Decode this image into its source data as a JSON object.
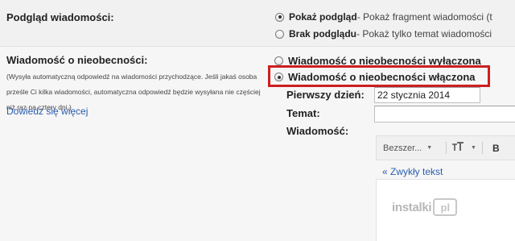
{
  "preview": {
    "label": "Podgląd wiadomości:",
    "options": [
      {
        "title": "Pokaż podgląd",
        "desc": " - Pokaż fragment wiadomości (t",
        "checked": true
      },
      {
        "title": "Brak podglądu",
        "desc": " - Pokaż tylko temat wiadomości",
        "checked": false
      }
    ]
  },
  "vacation": {
    "label": "Wiadomość o nieobecności:",
    "description": "(Wysyła automatyczną odpowiedź na wiadomości przychodzące. Jeśli jakaś osoba prześle Ci kilka wiadomości, automatyczna odpowiedź będzie wysyłana nie częściej niż raz na cztery dni.)",
    "learn_more": "Dowiedz się więcej",
    "options": [
      {
        "label": "Wiadomość o nieobecności wyłączona",
        "checked": false
      },
      {
        "label": "Wiadomość o nieobecności włączona",
        "checked": true
      }
    ],
    "first_day_label": "Pierwszy dzień:",
    "first_day_value": "22 stycznia 2014",
    "subject_label": "Temat:",
    "subject_value": "",
    "message_label": "Wiadomość:"
  },
  "toolbar": {
    "font_name": "Bezszer...",
    "size_icon": "text-size-icon",
    "bold_label": "B"
  },
  "editor": {
    "plain_text_link": "« Zwykły tekst"
  },
  "watermark": {
    "text": "instalki",
    "box": "pl"
  },
  "colors": {
    "highlight": "#cc1f1f",
    "link": "#2a5db0"
  }
}
